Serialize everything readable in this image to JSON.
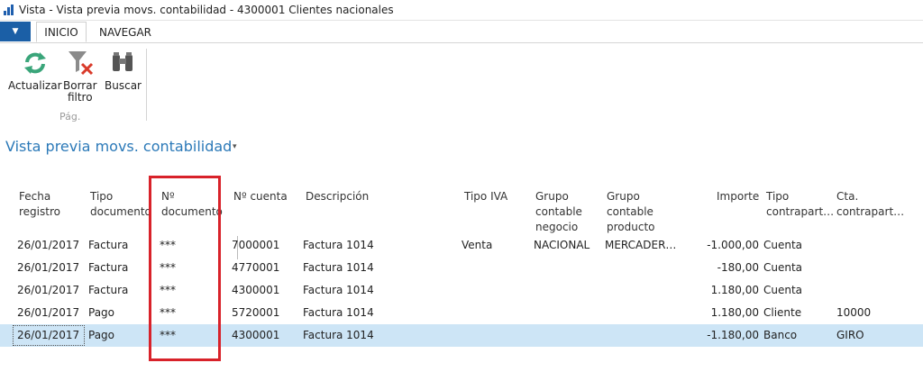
{
  "window": {
    "title": "Vista - Vista previa movs. contabilidad - 4300001 Clientes nacionales"
  },
  "ribbon": {
    "menu_glyph": "▼",
    "tabs": [
      "INICIO",
      "NAVEGAR"
    ],
    "buttons": {
      "refresh": "Actualizar",
      "clear_filter_1": "Borrar",
      "clear_filter_2": "filtro",
      "find": "Buscar"
    },
    "group_label": "Pág."
  },
  "page": {
    "title": "Vista previa movs. contabilidad",
    "caret": "▾"
  },
  "table": {
    "headers": {
      "fecha_1": "Fecha",
      "fecha_2": "registro",
      "tipo_doc_1": "Tipo",
      "tipo_doc_2": "documento",
      "n_doc_1": "Nº",
      "n_doc_2": "documento",
      "n_cuenta": "Nº cuenta",
      "descripcion": "Descripción",
      "tipo_iva": "Tipo IVA",
      "grupo_neg_1": "Grupo",
      "grupo_neg_2": "contable",
      "grupo_neg_3": "negocio",
      "grupo_prod_1": "Grupo",
      "grupo_prod_2": "contable",
      "grupo_prod_3": "producto",
      "importe": "Importe",
      "tipo_contra_1": "Tipo",
      "tipo_contra_2": "contrapart…",
      "cta_contra_1": "Cta.",
      "cta_contra_2": "contrapart…"
    },
    "rows": [
      {
        "fecha": "26/01/2017",
        "tipo_doc": "Factura",
        "n_doc": "***",
        "cuenta": "7000001",
        "descripcion": "Factura 1014",
        "tipo_iva": "Venta",
        "grupo_neg": "NACIONAL",
        "grupo_prod": "MERCADER…",
        "importe": "-1.000,00",
        "tipo_contra": "Cuenta",
        "cta_contra": ""
      },
      {
        "fecha": "26/01/2017",
        "tipo_doc": "Factura",
        "n_doc": "***",
        "cuenta": "4770001",
        "descripcion": "Factura 1014",
        "tipo_iva": "",
        "grupo_neg": "",
        "grupo_prod": "",
        "importe": "-180,00",
        "tipo_contra": "Cuenta",
        "cta_contra": ""
      },
      {
        "fecha": "26/01/2017",
        "tipo_doc": "Factura",
        "n_doc": "***",
        "cuenta": "4300001",
        "descripcion": "Factura 1014",
        "tipo_iva": "",
        "grupo_neg": "",
        "grupo_prod": "",
        "importe": "1.180,00",
        "tipo_contra": "Cuenta",
        "cta_contra": ""
      },
      {
        "fecha": "26/01/2017",
        "tipo_doc": "Pago",
        "n_doc": "***",
        "cuenta": "5720001",
        "descripcion": "Factura 1014",
        "tipo_iva": "",
        "grupo_neg": "",
        "grupo_prod": "",
        "importe": "1.180,00",
        "tipo_contra": "Cliente",
        "cta_contra": "10000"
      },
      {
        "fecha": "26/01/2017",
        "tipo_doc": "Pago",
        "n_doc": "***",
        "cuenta": "4300001",
        "descripcion": "Factura 1014",
        "tipo_iva": "",
        "grupo_neg": "",
        "grupo_prod": "",
        "importe": "-1.180,00",
        "tipo_contra": "Banco",
        "cta_contra": "GIRO"
      }
    ]
  },
  "colors": {
    "accent": "#1b5fa6",
    "title_blue": "#2b79b8",
    "selected_row": "#cde5f6",
    "highlight": "#d8222a"
  }
}
